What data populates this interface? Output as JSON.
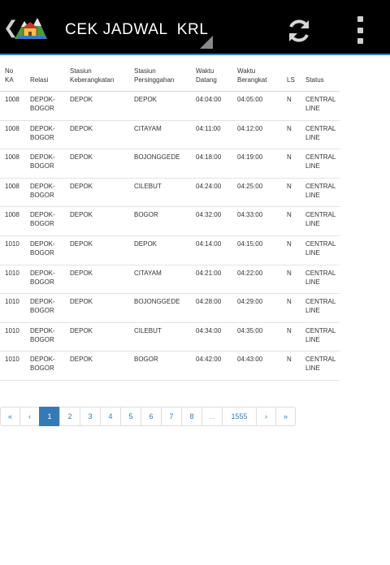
{
  "app": {
    "title": "CEK JADWAL  KRL"
  },
  "table": {
    "headers": {
      "no_ka": [
        "No",
        "KA"
      ],
      "relasi": [
        "",
        "Relasi"
      ],
      "stasiun_keberangkatan": [
        "Stasiun",
        "Keberangkatan"
      ],
      "stasiun_persinggahan": [
        "Stasiun",
        "Persinggahan"
      ],
      "waktu_datang": [
        "Waktu",
        "Datang"
      ],
      "waktu_berangkat": [
        "Waktu",
        "Berangkat"
      ],
      "ls": [
        "",
        "LS"
      ],
      "status": [
        "",
        "Status"
      ]
    },
    "rows": [
      {
        "no_ka": "1008",
        "relasi": [
          "DEPOK-",
          "BOGOR"
        ],
        "keberangkatan": "DEPOK",
        "persinggahan": "DEPOK",
        "datang": "04:04:00",
        "berangkat": "04:05:00",
        "ls": "N",
        "status": [
          "CENTRAL",
          "LINE"
        ]
      },
      {
        "no_ka": "1008",
        "relasi": [
          "DEPOK-",
          "BOGOR"
        ],
        "keberangkatan": "DEPOK",
        "persinggahan": "CITAYAM",
        "datang": "04:11:00",
        "berangkat": "04:12:00",
        "ls": "N",
        "status": [
          "CENTRAL",
          "LINE"
        ]
      },
      {
        "no_ka": "1008",
        "relasi": [
          "DEPOK-",
          "BOGOR"
        ],
        "keberangkatan": "DEPOK",
        "persinggahan": "BOJONGGEDE",
        "datang": "04:18:00",
        "berangkat": "04:19:00",
        "ls": "N",
        "status": [
          "CENTRAL",
          "LINE"
        ]
      },
      {
        "no_ka": "1008",
        "relasi": [
          "DEPOK-",
          "BOGOR"
        ],
        "keberangkatan": "DEPOK",
        "persinggahan": "CILEBUT",
        "datang": "04:24:00",
        "berangkat": "04:25:00",
        "ls": "N",
        "status": [
          "CENTRAL",
          "LINE"
        ]
      },
      {
        "no_ka": "1008",
        "relasi": [
          "DEPOK-",
          "BOGOR"
        ],
        "keberangkatan": "DEPOK",
        "persinggahan": "BOGOR",
        "datang": "04:32:00",
        "berangkat": "04:33:00",
        "ls": "N",
        "status": [
          "CENTRAL",
          "LINE"
        ]
      },
      {
        "no_ka": "1010",
        "relasi": [
          "DEPOK-",
          "BOGOR"
        ],
        "keberangkatan": "DEPOK",
        "persinggahan": "DEPOK",
        "datang": "04:14:00",
        "berangkat": "04:15:00",
        "ls": "N",
        "status": [
          "CENTRAL",
          "LINE"
        ]
      },
      {
        "no_ka": "1010",
        "relasi": [
          "DEPOK-",
          "BOGOR"
        ],
        "keberangkatan": "DEPOK",
        "persinggahan": "CITAYAM",
        "datang": "04:21:00",
        "berangkat": "04:22:00",
        "ls": "N",
        "status": [
          "CENTRAL",
          "LINE"
        ]
      },
      {
        "no_ka": "1010",
        "relasi": [
          "DEPOK-",
          "BOGOR"
        ],
        "keberangkatan": "DEPOK",
        "persinggahan": "BOJONGGEDE",
        "datang": "04:28:00",
        "berangkat": "04:29:00",
        "ls": "N",
        "status": [
          "CENTRAL",
          "LINE"
        ]
      },
      {
        "no_ka": "1010",
        "relasi": [
          "DEPOK-",
          "BOGOR"
        ],
        "keberangkatan": "DEPOK",
        "persinggahan": "CILEBUT",
        "datang": "04:34:00",
        "berangkat": "04:35:00",
        "ls": "N",
        "status": [
          "CENTRAL",
          "LINE"
        ]
      },
      {
        "no_ka": "1010",
        "relasi": [
          "DEPOK-",
          "BOGOR"
        ],
        "keberangkatan": "DEPOK",
        "persinggahan": "BOGOR",
        "datang": "04:42:00",
        "berangkat": "04:43:00",
        "ls": "N",
        "status": [
          "CENTRAL",
          "LINE"
        ]
      }
    ]
  },
  "pagination": {
    "first": "«",
    "prev": "‹",
    "pages": [
      "1",
      "2",
      "3",
      "4",
      "5",
      "6",
      "7",
      "8"
    ],
    "active_page": "1",
    "ellipsis": "...",
    "last_page": "1555",
    "next": "›",
    "last": "»"
  },
  "icons": {
    "back": "chevron-left-icon",
    "logo": "app-logo-icon",
    "refresh": "refresh-icon",
    "overflow": "overflow-menu-icon"
  },
  "colors": {
    "actionbar": "#000000",
    "accent": "#2a86d6",
    "page_active": "#337ab7",
    "link": "#337ab7"
  }
}
